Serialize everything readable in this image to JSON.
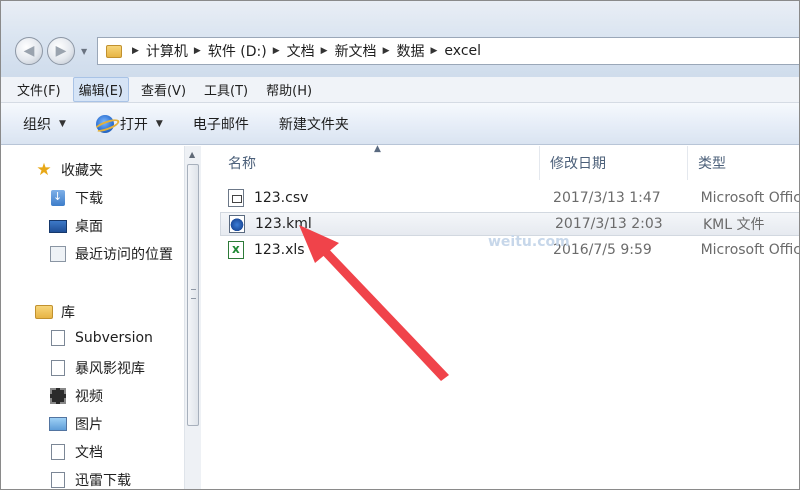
{
  "breadcrumb": [
    "计算机",
    "软件 (D:)",
    "文档",
    "新文档",
    "数据",
    "excel"
  ],
  "menu": [
    {
      "label": "文件(F)",
      "active": false
    },
    {
      "label": "编辑(E)",
      "active": true
    },
    {
      "label": "查看(V)",
      "active": false
    },
    {
      "label": "工具(T)",
      "active": false
    },
    {
      "label": "帮助(H)",
      "active": false
    }
  ],
  "toolbar": {
    "organize": "组织",
    "open": "打开",
    "email": "电子邮件",
    "new_folder": "新建文件夹"
  },
  "nav": {
    "favorites": "收藏夹",
    "downloads": "下载",
    "desktop": "桌面",
    "recent": "最近访问的位置",
    "libraries": "库",
    "subversion": "Subversion",
    "baofeng": "暴风影视库",
    "videos": "视频",
    "pictures": "图片",
    "documents": "文档",
    "thunder": "迅雷下载"
  },
  "columns": {
    "name": "名称",
    "date": "修改日期",
    "type": "类型"
  },
  "files": [
    {
      "name": "123.csv",
      "date": "2017/3/13 1:47",
      "type": "Microsoft Offic",
      "icon": "csv-file-icon"
    },
    {
      "name": "123.kml",
      "date": "2017/3/13 2:03",
      "type": "KML 文件",
      "icon": "kml-file-icon"
    },
    {
      "name": "123.xls",
      "date": "2016/7/5 9:59",
      "type": "Microsoft Offic",
      "icon": "xls-file-icon"
    }
  ],
  "watermark": "weitu.com",
  "colors": {
    "arrow": "#f0434a",
    "selected_row": "#e9edf2",
    "header_text": "#4c607a"
  }
}
